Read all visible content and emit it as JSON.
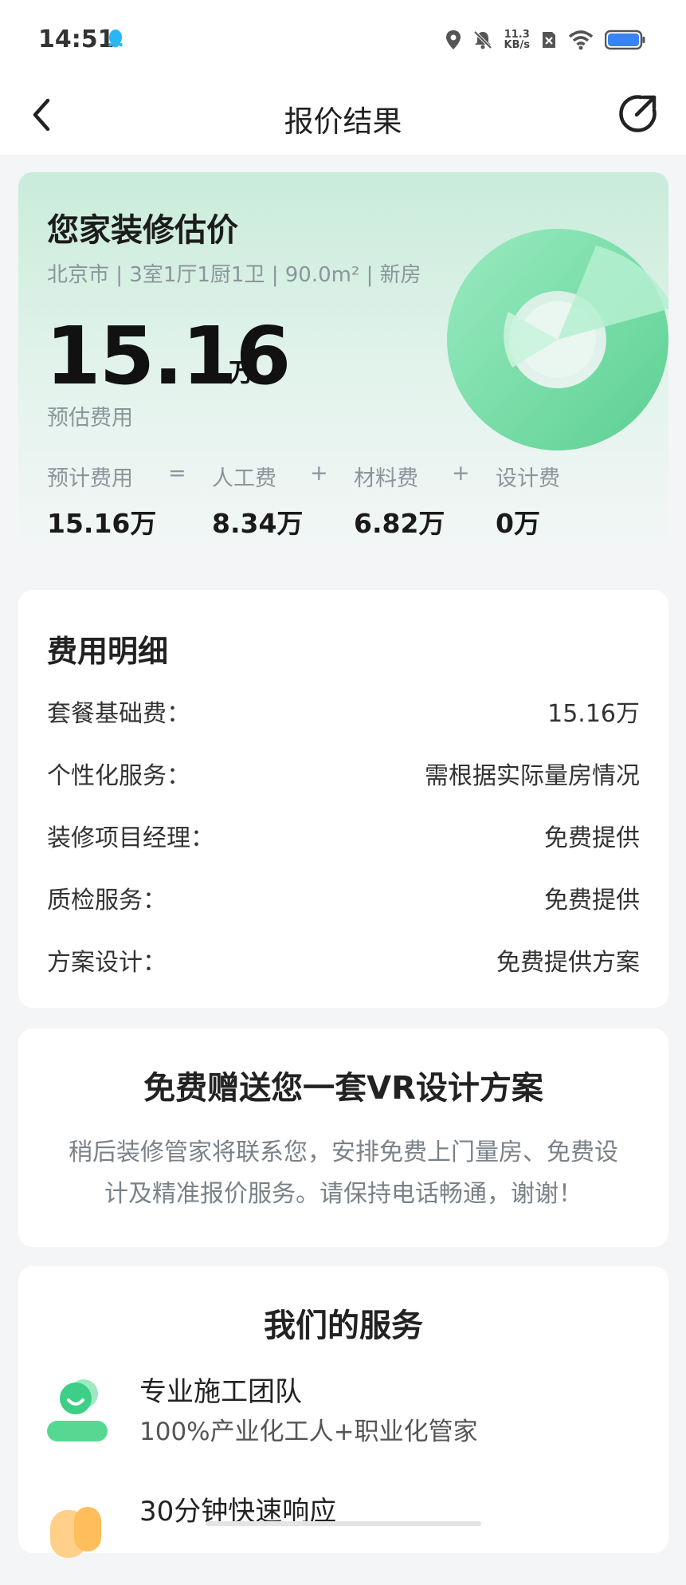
{
  "status_bar": {
    "time": "14:51",
    "net_speed_value": "11.3",
    "net_speed_unit": "KB/s",
    "icons": [
      "qq-icon",
      "location-icon",
      "mute-icon",
      "sim-off-icon",
      "wifi-icon",
      "battery-icon"
    ]
  },
  "nav": {
    "title": "报价结果",
    "back_icon": "back-icon",
    "share_icon": "share-icon"
  },
  "estimate": {
    "title": "您家装修估价",
    "subtitle": "北京市 | 3室1厅1厨1卫 | 90.0m² | 新房",
    "total_value": "15.16",
    "total_unit": "万",
    "total_caption": "预估费用",
    "breakdown": [
      {
        "label": "预计费用",
        "value": "15.16万"
      },
      {
        "op": "="
      },
      {
        "label": "人工费",
        "value": "8.34万"
      },
      {
        "op": "+"
      },
      {
        "label": "材料费",
        "value": "6.82万"
      },
      {
        "op": "+"
      },
      {
        "label": "设计费",
        "value": "0万"
      }
    ],
    "accent_color": "#5fd79c"
  },
  "details": {
    "title": "费用明细",
    "rows": [
      {
        "key": "套餐基础费：",
        "value": "15.16万"
      },
      {
        "key": "个性化服务：",
        "value": "需根据实际量房情况"
      },
      {
        "key": "装修项目经理：",
        "value": "免费提供"
      },
      {
        "key": "质检服务：",
        "value": "免费提供"
      },
      {
        "key": "方案设计：",
        "value": "免费提供方案"
      }
    ]
  },
  "vr_offer": {
    "title": "免费赠送您一套VR设计方案",
    "line1": "稍后装修管家将联系您，安排免费上门量房、免费设",
    "line2": "计及精准报价服务。请保持电话畅通，谢谢！"
  },
  "services": {
    "title": "我们的服务",
    "items": [
      {
        "name": "专业施工团队",
        "desc": "100%产业化工人+职业化管家",
        "icon": "worker-team-icon"
      },
      {
        "name": "30分钟快速响应",
        "desc": "",
        "icon": "fast-response-icon"
      }
    ]
  }
}
